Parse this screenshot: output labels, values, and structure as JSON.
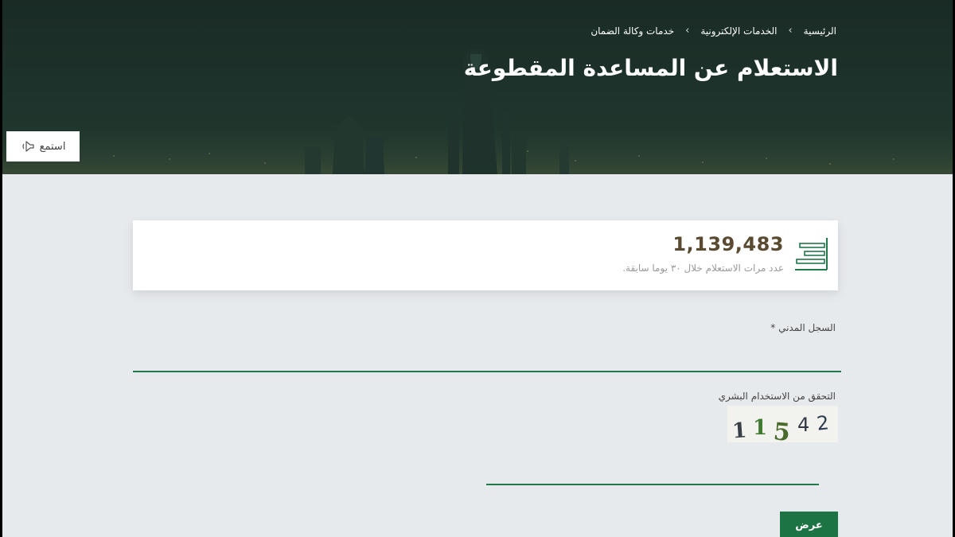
{
  "breadcrumb": {
    "items": [
      "الرئيسية",
      "الخدمات الإلكترونية",
      "خدمات وكالة الضمان"
    ],
    "separator": "›"
  },
  "page_title": "الاستعلام عن المساعدة المقطوعة",
  "listen_button": {
    "label": "استمع",
    "icon": "speaker-icon"
  },
  "stats": {
    "value": "1,139,483",
    "caption": "عدد مرات الاستعلام خلال ٣٠ يوما سابقة.",
    "icon": "bar-chart-icon",
    "value_color": "#5b4a32"
  },
  "form": {
    "civil_registry_label": "السجل المدني *",
    "civil_registry_value": "",
    "captcha_label": "التحقق من الاستخدام البشري",
    "captcha_value": "",
    "captcha_digits": [
      "1",
      "1",
      "5",
      "4",
      "2"
    ],
    "submit_label": "عرض"
  },
  "colors": {
    "accent": "#1c7444",
    "hero_bg": "#1d332b",
    "page_bg": "#e7eaed"
  }
}
